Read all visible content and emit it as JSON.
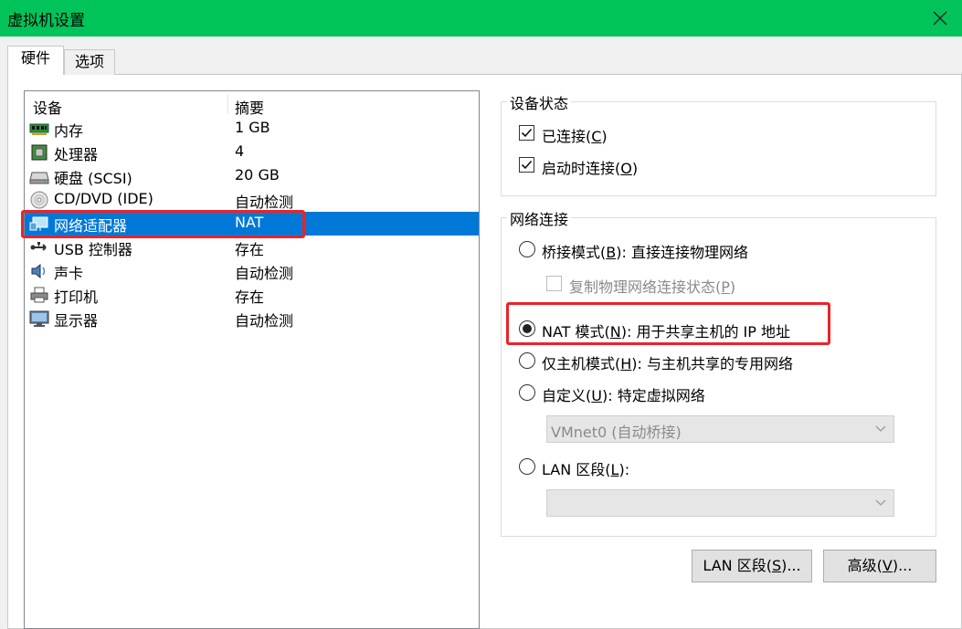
{
  "window": {
    "title": "虚拟机设置"
  },
  "tabs": [
    {
      "label": "硬件",
      "active": true
    },
    {
      "label": "选项",
      "active": false
    }
  ],
  "device_list": {
    "columns": [
      "设备",
      "摘要"
    ],
    "rows": [
      {
        "icon": "memory-icon",
        "name": "内存",
        "summary": "1 GB"
      },
      {
        "icon": "processor-icon",
        "name": "处理器",
        "summary": "4"
      },
      {
        "icon": "hard-disk-icon",
        "name": "硬盘 (SCSI)",
        "summary": "20 GB"
      },
      {
        "icon": "cd-dvd-icon",
        "name": "CD/DVD (IDE)",
        "summary": "自动检测"
      },
      {
        "icon": "network-adapter-icon",
        "name": "网络适配器",
        "summary": "NAT",
        "selected": true
      },
      {
        "icon": "usb-icon",
        "name": "USB 控制器",
        "summary": "存在"
      },
      {
        "icon": "sound-card-icon",
        "name": "声卡",
        "summary": "自动检测"
      },
      {
        "icon": "printer-icon",
        "name": "打印机",
        "summary": "存在"
      },
      {
        "icon": "display-icon",
        "name": "显示器",
        "summary": "自动检测"
      }
    ]
  },
  "device_status": {
    "title": "设备状态",
    "connected": {
      "text": "已连接(",
      "key": "C",
      "end": ")",
      "checked": true
    },
    "connect_at_power_on": {
      "text": "启动时连接(",
      "key": "O",
      "end": ")",
      "checked": true
    }
  },
  "network_connection": {
    "title": "网络连接",
    "bridged": {
      "text": "桥接模式(",
      "key": "B",
      "end": "): 直接连接物理网络",
      "selected": false
    },
    "replicate": {
      "text": "复制物理网络连接状态(",
      "key": "P",
      "end": ")",
      "checked": false,
      "disabled": true
    },
    "nat": {
      "text": "NAT 模式(",
      "key": "N",
      "end": "): 用于共享主机的 IP 地址",
      "selected": true
    },
    "host_only": {
      "text": "仅主机模式(",
      "key": "H",
      "end": "): 与主机共享的专用网络",
      "selected": false
    },
    "custom": {
      "text": "自定义(",
      "key": "U",
      "end": "): 特定虚拟网络",
      "selected": false
    },
    "custom_select": {
      "value": "VMnet0 (自动桥接)"
    },
    "lan_segment": {
      "text": "LAN 区段(",
      "key": "L",
      "end": "):",
      "selected": false
    },
    "lan_select": {
      "value": ""
    }
  },
  "buttons": {
    "lan_segments": {
      "text": "LAN 区段(",
      "key": "S",
      "end": ")..."
    },
    "advanced": {
      "text": "高级(",
      "key": "V",
      "end": ")..."
    }
  },
  "colors": {
    "titlebar": "#00c45a",
    "selection": "#0078d7",
    "highlight_box": "#e8242b"
  }
}
